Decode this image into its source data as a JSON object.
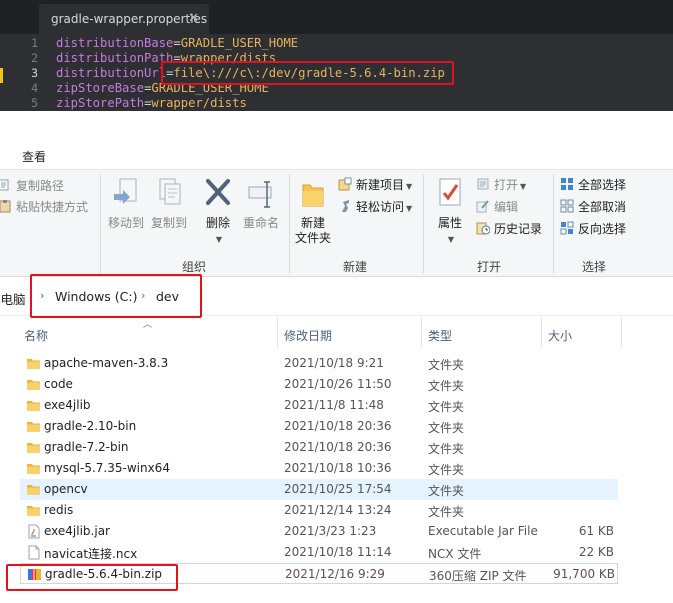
{
  "editor": {
    "tab_title": "gradle-wrapper.properties",
    "lines": [
      {
        "num": "1",
        "key": "distributionBase",
        "value": "GRADLE_USER_HOME"
      },
      {
        "num": "2",
        "key": "distributionPath",
        "value": "wrapper/dists"
      },
      {
        "num": "3",
        "key": "distributionUrl",
        "value": "file\\:///c\\:/dev/gradle-5.6.4-bin.zip"
      },
      {
        "num": "4",
        "key": "zipStoreBase",
        "value": "GRADLE_USER_HOME"
      },
      {
        "num": "5",
        "key": "zipStorePath",
        "value": "wrapper/dists"
      }
    ]
  },
  "ribbon": {
    "tab_label": "查看",
    "clipboard": {
      "copy_path": "复制路径",
      "paste_shortcut": "粘贴快捷方式"
    },
    "organize": {
      "label": "组织",
      "move_to": "移动到",
      "copy_to": "复制到",
      "delete": "删除",
      "rename": "重命名"
    },
    "new": {
      "label": "新建",
      "new_folder_line1": "新建",
      "new_folder_line2": "文件夹",
      "new_item": "新建项目",
      "easy_access": "轻松访问"
    },
    "open": {
      "label": "打开",
      "properties": "属性",
      "open": "打开",
      "edit": "编辑",
      "history": "历史记录"
    },
    "select": {
      "label": "选择",
      "select_all": "全部选择",
      "select_none": "全部取消",
      "invert": "反向选择"
    }
  },
  "address": {
    "root": "此电脑",
    "crumbs": [
      "Windows (C:)",
      "dev"
    ]
  },
  "columns": {
    "name": "名称",
    "modified": "修改日期",
    "type": "类型",
    "size": "大小"
  },
  "files": [
    {
      "name": "apache-maven-3.8.3",
      "modified": "2021/10/18 9:21",
      "type": "文件夹",
      "size": "",
      "icon": "folder-icon"
    },
    {
      "name": "code",
      "modified": "2021/10/26 11:50",
      "type": "文件夹",
      "size": "",
      "icon": "folder-icon"
    },
    {
      "name": "exe4jlib",
      "modified": "2021/11/8 11:48",
      "type": "文件夹",
      "size": "",
      "icon": "folder-icon"
    },
    {
      "name": "gradle-2.10-bin",
      "modified": "2021/10/18 20:36",
      "type": "文件夹",
      "size": "",
      "icon": "folder-icon"
    },
    {
      "name": "gradle-7.2-bin",
      "modified": "2021/10/18 20:36",
      "type": "文件夹",
      "size": "",
      "icon": "folder-icon"
    },
    {
      "name": "mysql-5.7.35-winx64",
      "modified": "2021/10/18 10:36",
      "type": "文件夹",
      "size": "",
      "icon": "folder-icon"
    },
    {
      "name": "opencv",
      "modified": "2021/10/25 17:54",
      "type": "文件夹",
      "size": "",
      "icon": "folder-icon"
    },
    {
      "name": "redis",
      "modified": "2021/12/14 13:24",
      "type": "文件夹",
      "size": "",
      "icon": "folder-icon"
    },
    {
      "name": "exe4jlib.jar",
      "modified": "2021/3/23 1:23",
      "type": "Executable Jar File",
      "size": "61 KB",
      "icon": "jar-icon"
    },
    {
      "name": "navicat连接.ncx",
      "modified": "2021/10/18 11:14",
      "type": "NCX 文件",
      "size": "22 KB",
      "icon": "file-icon"
    },
    {
      "name": "gradle-5.6.4-bin.zip",
      "modified": "2021/12/16 9:29",
      "type": "360压缩 ZIP 文件",
      "size": "91,700 KB",
      "icon": "zip-icon"
    }
  ]
}
